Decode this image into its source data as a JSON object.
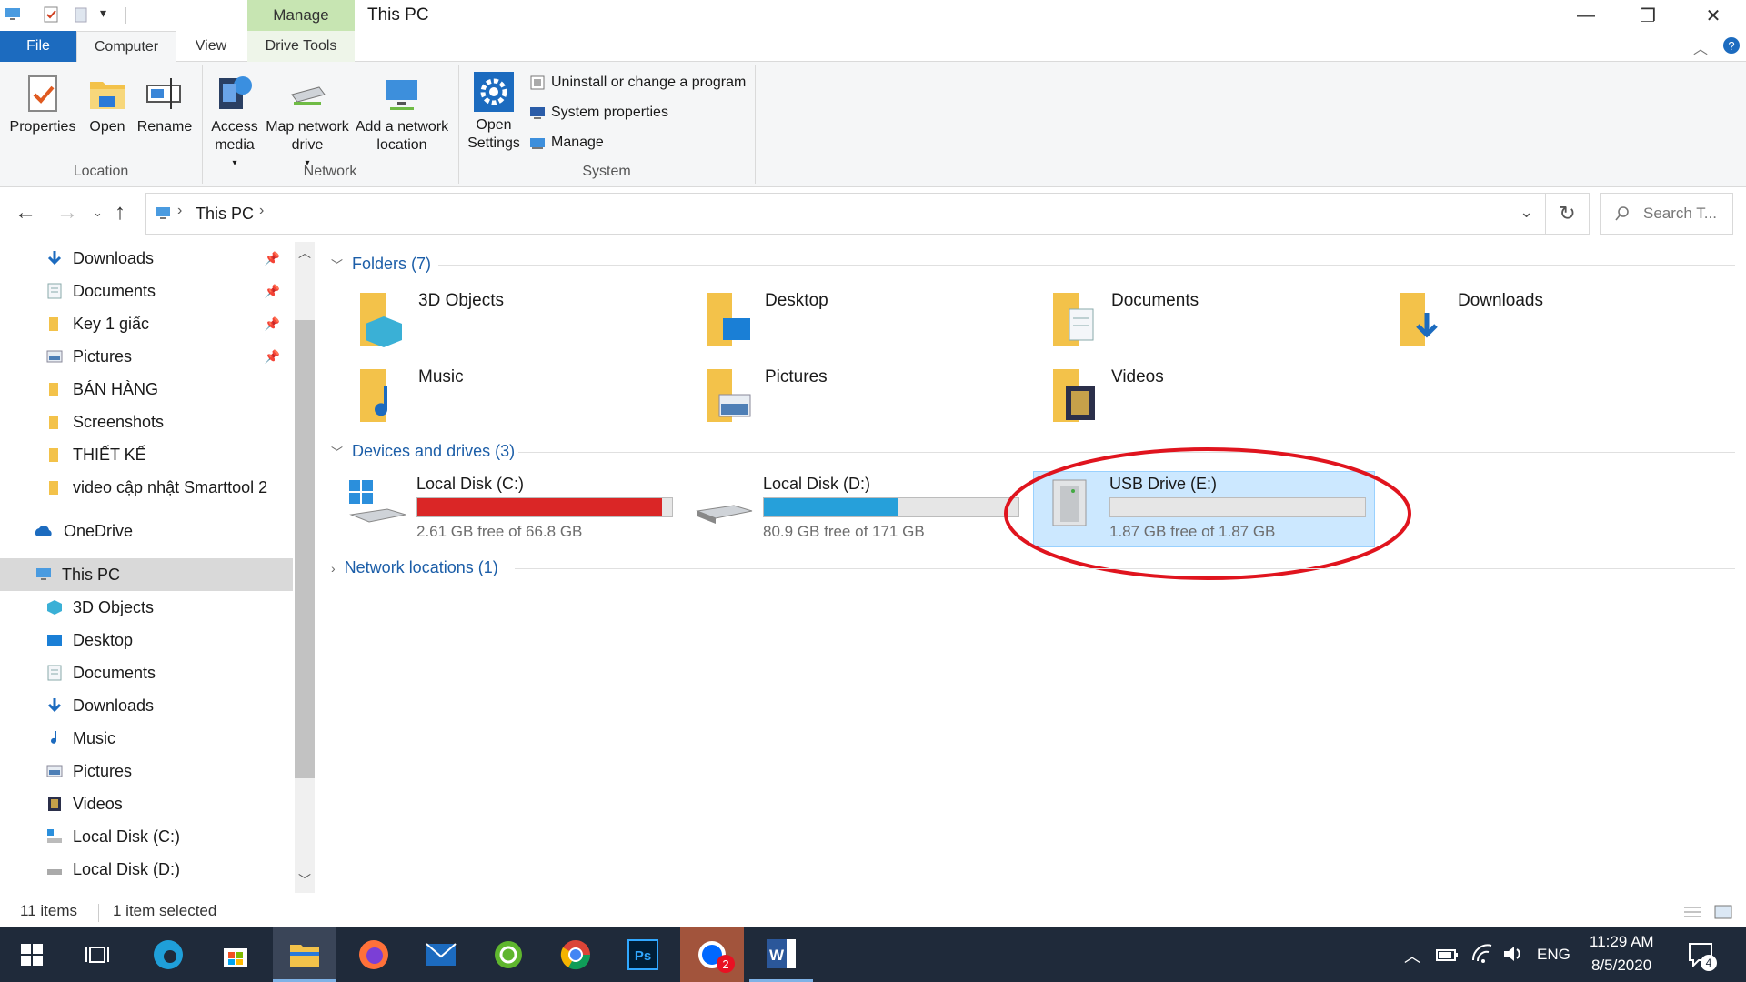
{
  "window": {
    "title": "This PC",
    "manage_tab": "Manage",
    "minimize": "—",
    "restore": "❐",
    "close": "✕"
  },
  "tabs": {
    "file": "File",
    "computer": "Computer",
    "view": "View",
    "drive_tools": "Drive Tools"
  },
  "ribbon": {
    "location": {
      "label": "Location",
      "properties": "Properties",
      "open": "Open",
      "rename": "Rename"
    },
    "network": {
      "label": "Network",
      "access_media": "Access media",
      "map_drive": "Map network drive",
      "add_location": "Add a network location"
    },
    "system": {
      "label": "System",
      "open_settings": "Open Settings",
      "uninstall": "Uninstall or change a program",
      "system_properties": "System properties",
      "manage": "Manage"
    }
  },
  "address": {
    "path": "This PC",
    "search_placeholder": "Search T..."
  },
  "nav_pane": {
    "quick_access": [
      {
        "label": "Downloads",
        "pinned": true
      },
      {
        "label": "Documents",
        "pinned": true
      },
      {
        "label": "Key 1 giấc",
        "pinned": true
      },
      {
        "label": "Pictures",
        "pinned": true
      },
      {
        "label": "BÁN HÀNG",
        "pinned": false
      },
      {
        "label": "Screenshots",
        "pinned": false
      },
      {
        "label": "THIẾT KẾ",
        "pinned": false
      },
      {
        "label": "video cập nhật Smarttool 2",
        "pinned": false
      }
    ],
    "onedrive": "OneDrive",
    "this_pc": "This PC",
    "this_pc_items": [
      "3D Objects",
      "Desktop",
      "Documents",
      "Downloads",
      "Music",
      "Pictures",
      "Videos",
      "Local Disk (C:)",
      "Local Disk (D:)"
    ]
  },
  "content": {
    "folders_header": "Folders (7)",
    "folders": [
      "3D Objects",
      "Desktop",
      "Documents",
      "Downloads",
      "Music",
      "Pictures",
      "Videos"
    ],
    "devices_header": "Devices and drives (3)",
    "drives": [
      {
        "name": "Local Disk (C:)",
        "free": "2.61 GB free of 66.8 GB",
        "used_fraction": 0.96,
        "color": "#da2626"
      },
      {
        "name": "Local Disk (D:)",
        "free": "80.9 GB free of 171 GB",
        "used_fraction": 0.53,
        "color": "#26a0da"
      },
      {
        "name": "USB Drive (E:)",
        "free": "1.87 GB free of 1.87 GB",
        "used_fraction": 0.0,
        "color": "#26a0da"
      }
    ],
    "network_header": "Network locations (1)"
  },
  "status": {
    "items": "11 items",
    "selected": "1 item selected"
  },
  "taskbar": {
    "zalo_badge": "2",
    "lang": "ENG",
    "time": "11:29 AM",
    "date": "8/5/2020",
    "notif_count": "4"
  },
  "colors": {
    "accent": "#1c6bbf",
    "selected_bg": "#cce8ff",
    "highlight_ellipse": "#e0141e"
  }
}
